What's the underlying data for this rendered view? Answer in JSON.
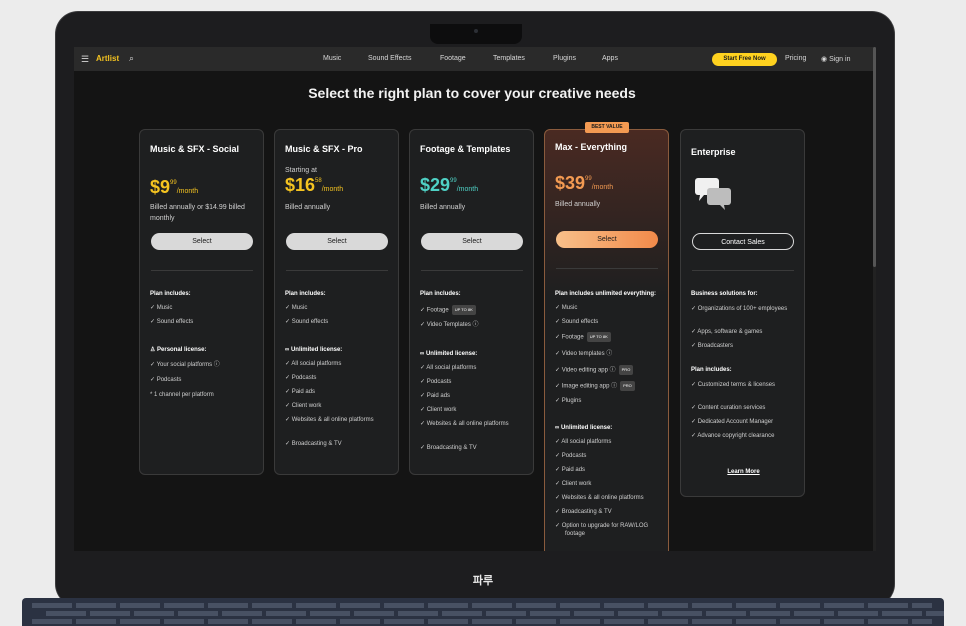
{
  "brand_label": "파루",
  "nav": {
    "logo": "Artlist",
    "links": [
      "Music",
      "Sound Effects",
      "Footage",
      "Templates",
      "Plugins",
      "Apps"
    ],
    "start_button": "Start Free Now",
    "pricing": "Pricing",
    "signin": "Sign in"
  },
  "headline": "Select the right plan to cover your creative needs",
  "plans": [
    {
      "title": "Music & SFX - Social",
      "price_main": "$9",
      "price_cents": "99",
      "price_period": "/month",
      "billed": "Billed annually or $14.99 billed monthly",
      "button": "Select",
      "includes_head": "Plan includes:",
      "includes": [
        "Music",
        "Sound effects"
      ],
      "license_head": "Personal license:",
      "license": [
        "Your social platforms ⓘ",
        "Podcasts"
      ],
      "note": "* 1 channel per platform"
    },
    {
      "title": "Music & SFX - Pro",
      "starting": "Starting at",
      "price_main": "$16",
      "price_cents": "58",
      "price_period": "/month",
      "billed": "Billed annually",
      "button": "Select",
      "includes_head": "Plan includes:",
      "includes": [
        "Music",
        "Sound effects"
      ],
      "license_head": "Unlimited license:",
      "license": [
        "All social platforms",
        "Podcasts",
        "Paid ads",
        "Client work",
        "Websites & all online platforms",
        "Broadcasting & TV"
      ]
    },
    {
      "title": "Footage & Templates",
      "price_main": "$29",
      "price_cents": "99",
      "price_period": "/month",
      "billed": "Billed annually",
      "button": "Select",
      "includes_head": "Plan includes:",
      "includes": [
        "Footage",
        "Video Templates ⓘ"
      ],
      "includes_tag": "UP TO 8K",
      "license_head": "Unlimited license:",
      "license": [
        "All social platforms",
        "Podcasts",
        "Paid ads",
        "Client work",
        "Websites & all online platforms",
        "Broadcasting & TV"
      ]
    },
    {
      "badge": "BEST VALUE",
      "title": "Max - Everything",
      "price_main": "$39",
      "price_cents": "99",
      "price_period": "/month",
      "billed": "Billed annually",
      "button": "Select",
      "includes_head": "Plan includes unlimited everything:",
      "includes": [
        "Music",
        "Sound effects",
        "Footage",
        "Video templates ⓘ",
        "Video editing app ⓘ",
        "Image editing app ⓘ",
        "Plugins"
      ],
      "footage_tag": "UP TO 8K",
      "pro_tag": "PRO",
      "license_head": "Unlimited license:",
      "license": [
        "All social platforms",
        "Podcasts",
        "Paid ads",
        "Client work",
        "Websites & all online platforms",
        "Broadcasting & TV",
        "Option to upgrade for RAW/LOG footage"
      ]
    },
    {
      "title": "Enterprise",
      "button": "Contact Sales",
      "includes_head": "Business solutions for:",
      "includes": [
        "Organizations of 100+ employees",
        "Apps, software & games",
        "Broadcasters"
      ],
      "license_head": "Plan includes:",
      "license": [
        "Customized terms & licenses",
        "Content curation services",
        "Dedicated Account Manager",
        "Advance copyright clearance"
      ],
      "learn_more": "Learn More"
    }
  ],
  "colors": {
    "accent_yellow": "#f4c320",
    "teal": "#4fd1c5",
    "orange": "#f39a52"
  }
}
